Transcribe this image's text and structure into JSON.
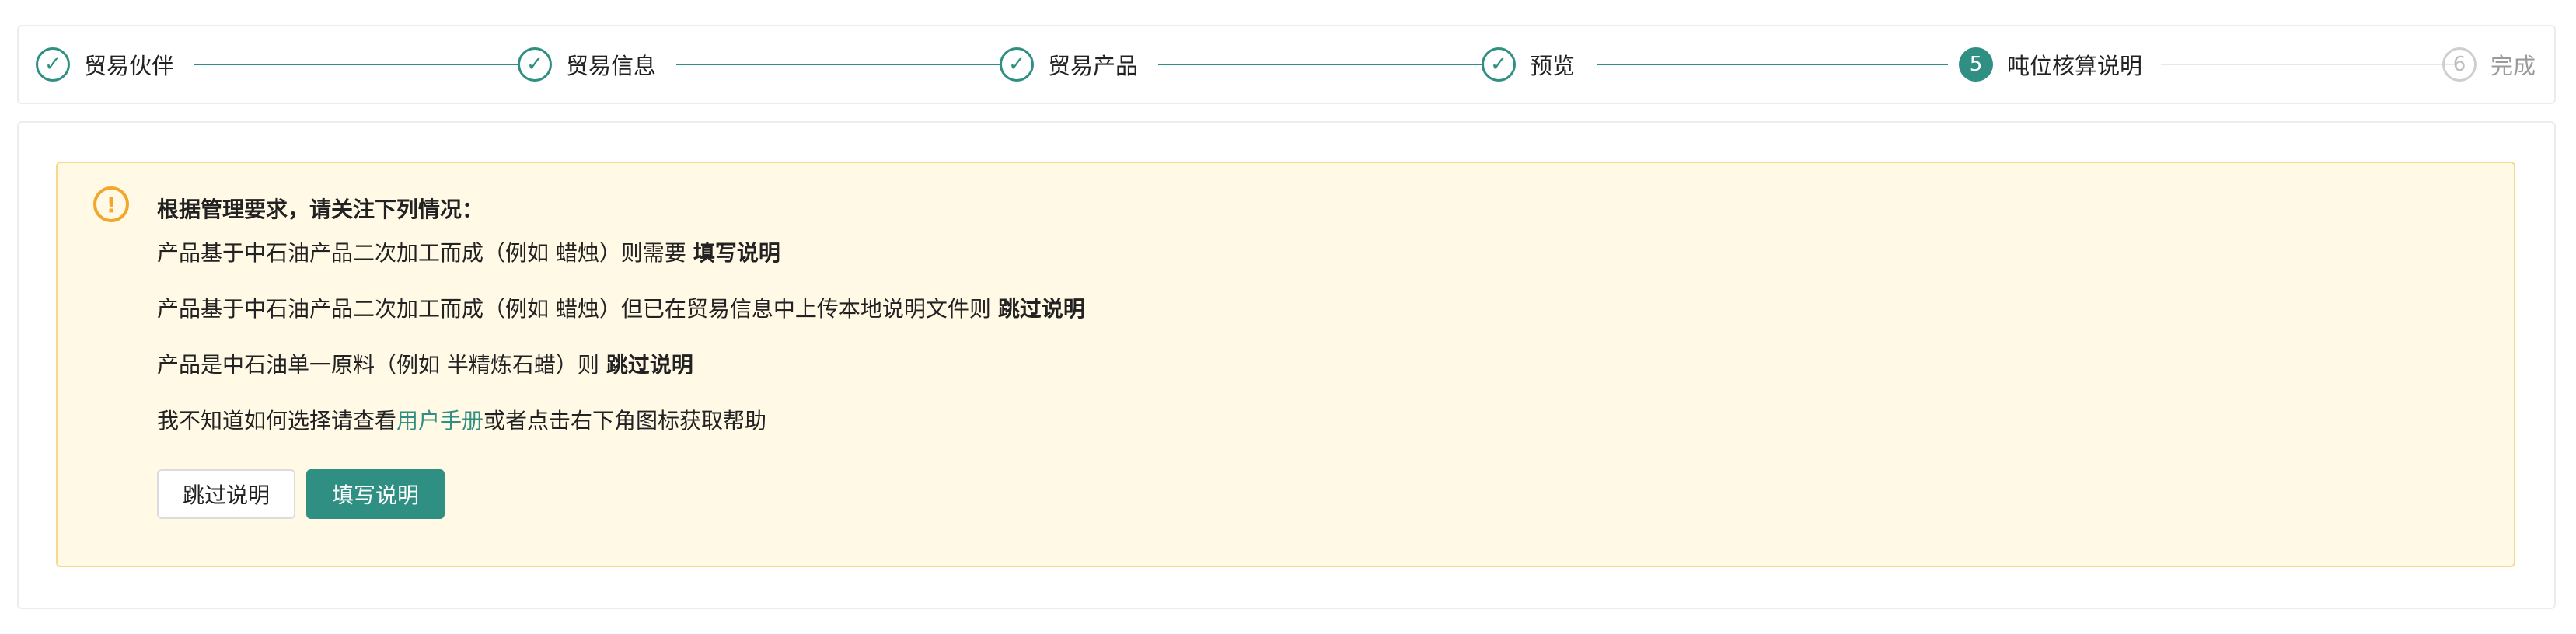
{
  "steps": [
    {
      "label": "贸易伙伴",
      "state": "done",
      "marker": "✓"
    },
    {
      "label": "贸易信息",
      "state": "done",
      "marker": "✓"
    },
    {
      "label": "贸易产品",
      "state": "done",
      "marker": "✓"
    },
    {
      "label": "预览",
      "state": "done",
      "marker": "✓"
    },
    {
      "label": "吨位核算说明",
      "state": "active",
      "marker": "5"
    },
    {
      "label": "完成",
      "state": "pending",
      "marker": "6"
    }
  ],
  "notice": {
    "icon": "!",
    "title": "根据管理要求，请关注下列情况：",
    "line1_text": "产品基于中石油产品二次加工而成（例如 蜡烛）则需要 ",
    "line1_bold": "填写说明",
    "line2_text": "产品基于中石油产品二次加工而成（例如 蜡烛）但已在贸易信息中上传本地说明文件则 ",
    "line2_bold": "跳过说明",
    "line3_text": "产品是中石油单一原料（例如 半精炼石蜡）则 ",
    "line3_bold": "跳过说明",
    "line4_prefix": "我不知道如何选择请查看",
    "line4_link": "用户手册",
    "line4_suffix": "或者点击右下角图标获取帮助"
  },
  "buttons": {
    "skip_label": "跳过说明",
    "fill_label": "填写说明"
  },
  "colors": {
    "accent": "#2e8f82",
    "warning": "#f2a72c",
    "notice_bg": "#fff9e6",
    "notice_border": "#f5d98c"
  }
}
